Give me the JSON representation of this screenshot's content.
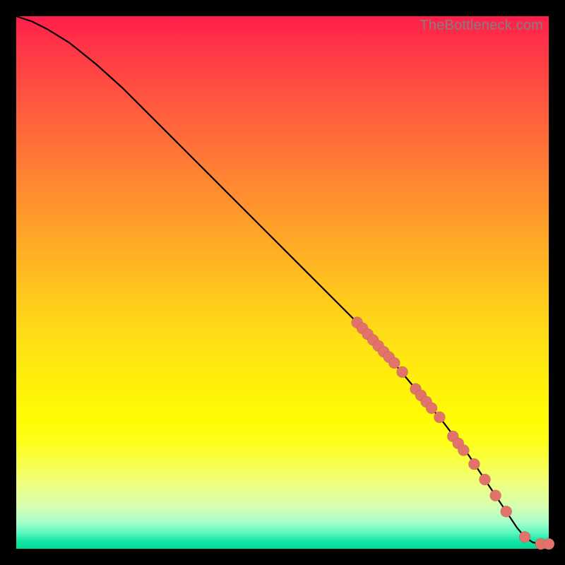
{
  "attribution": "TheBottleneck.com",
  "colors": {
    "dot_fill": "#e2736b",
    "curve_stroke": "#000000"
  },
  "chart_data": {
    "type": "line",
    "title": "",
    "xlabel": "",
    "ylabel": "",
    "xlim": [
      0,
      100
    ],
    "ylim": [
      0,
      100
    ],
    "grid": false,
    "legend": false,
    "series": [
      {
        "name": "bottleneck-curve",
        "x": [
          0,
          3,
          6,
          10,
          15,
          20,
          30,
          40,
          50,
          60,
          64,
          70,
          75,
          80,
          85,
          88,
          90,
          92,
          94,
          95.5,
          97,
          98.5,
          100
        ],
        "y": [
          100,
          99,
          97.5,
          95,
          91,
          86.5,
          76.5,
          66.5,
          56.5,
          46.5,
          42.5,
          36,
          30,
          24,
          17.5,
          13,
          10,
          7,
          4,
          2.2,
          1.2,
          0.9,
          0.9
        ]
      }
    ],
    "scatter_points": {
      "name": "highlighted-points",
      "comment": "points drawn as salmon dots along lower-right portion of curve",
      "x": [
        64,
        65,
        66,
        67,
        68,
        69,
        70,
        71,
        72.5,
        75,
        76,
        77,
        78,
        79.5,
        82,
        83,
        84,
        86,
        88,
        90,
        92,
        95.5,
        98.5,
        100
      ],
      "y": [
        42.5,
        41.4,
        40.3,
        39.2,
        38.1,
        37.0,
        36.0,
        34.9,
        33.2,
        30.0,
        28.8,
        27.6,
        26.4,
        24.7,
        21.1,
        19.8,
        18.5,
        15.9,
        13.0,
        10.0,
        7.0,
        2.2,
        0.9,
        0.9
      ]
    }
  }
}
